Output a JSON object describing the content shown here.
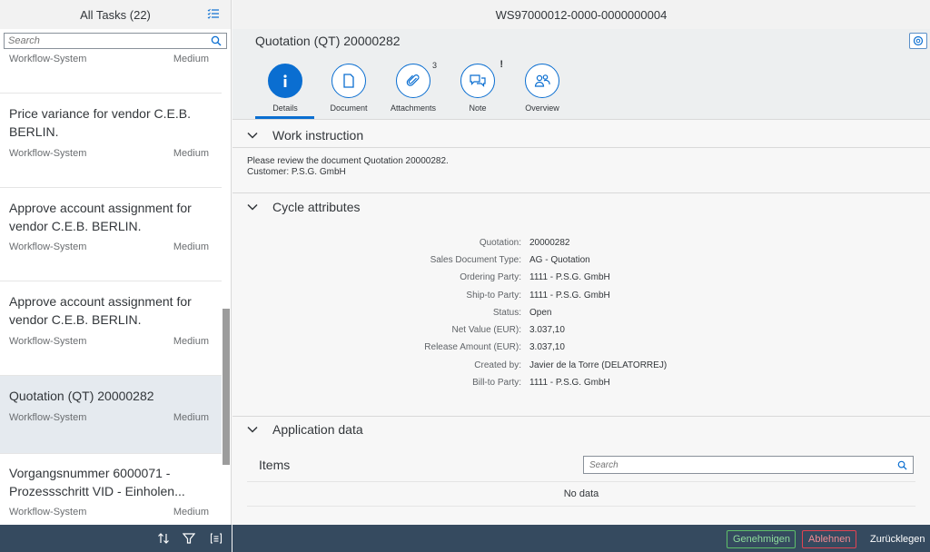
{
  "master": {
    "title": "All Tasks (22)",
    "search_placeholder": "Search",
    "items": [
      {
        "title": "",
        "creator": "Workflow-System",
        "priority": "Medium"
      },
      {
        "title": "Price variance for vendor C.E.B. BERLIN.",
        "creator": "Workflow-System",
        "priority": "Medium"
      },
      {
        "title": "Approve account assignment for vendor C.E.B. BERLIN.",
        "creator": "Workflow-System",
        "priority": "Medium"
      },
      {
        "title": "Approve account assignment for vendor C.E.B. BERLIN.",
        "creator": "Workflow-System",
        "priority": "Medium"
      },
      {
        "title": "Quotation (QT) 20000282",
        "creator": "Workflow-System",
        "priority": "Medium"
      },
      {
        "title": "Vorgangsnummer 6000071 - Prozessschritt VID - Einholen...",
        "creator": "Workflow-System",
        "priority": "Medium"
      }
    ],
    "footer_icons": [
      "sort-icon",
      "filter-icon",
      "group-icon"
    ]
  },
  "detail": {
    "top_title": "WS97000012-0000-0000000004",
    "header_title": "Quotation (QT) 20000282",
    "tabs": [
      {
        "label": "Details",
        "icon": "info-icon",
        "badge": ""
      },
      {
        "label": "Document",
        "icon": "document-icon",
        "badge": ""
      },
      {
        "label": "Attachments",
        "icon": "paperclip-icon",
        "badge": "3"
      },
      {
        "label": "Note",
        "icon": "note-icon",
        "badge": "!"
      },
      {
        "label": "Overview",
        "icon": "people-icon",
        "badge": ""
      }
    ],
    "work_instruction": {
      "title": "Work instruction",
      "line1": "Please review the document Quotation 20000282.",
      "line2": "Customer: P.S.G. GmbH"
    },
    "cycle_attributes": {
      "title": "Cycle attributes",
      "rows": [
        {
          "key": "Quotation:",
          "value": "20000282"
        },
        {
          "key": "Sales Document Type:",
          "value": "AG - Quotation"
        },
        {
          "key": "Ordering Party:",
          "value": "1111 - P.S.G. GmbH"
        },
        {
          "key": "Ship-to Party:",
          "value": "1111 - P.S.G. GmbH"
        },
        {
          "key": "Status:",
          "value": "Open"
        },
        {
          "key": "Net Value (EUR):",
          "value": "3.037,10"
        },
        {
          "key": "Release Amount (EUR):",
          "value": "3.037,10"
        },
        {
          "key": "Created by:",
          "value": "Javier de la Torre (DELATORREJ)"
        },
        {
          "key": "Bill-to Party:",
          "value": "1111 - P.S.G. GmbH"
        }
      ]
    },
    "application_data": {
      "title": "Application data",
      "items_title": "Items",
      "search_placeholder": "Search",
      "no_data": "No data"
    },
    "footer": {
      "accept": "Genehmigen",
      "reject": "Ablehnen",
      "defer": "Zurücklegen"
    }
  },
  "colors": {
    "accent": "#0a6ed1",
    "footer_bg": "#354a5f",
    "accept": "#5ec06a",
    "reject": "#e34352",
    "selected_row": "#e5eaef"
  }
}
